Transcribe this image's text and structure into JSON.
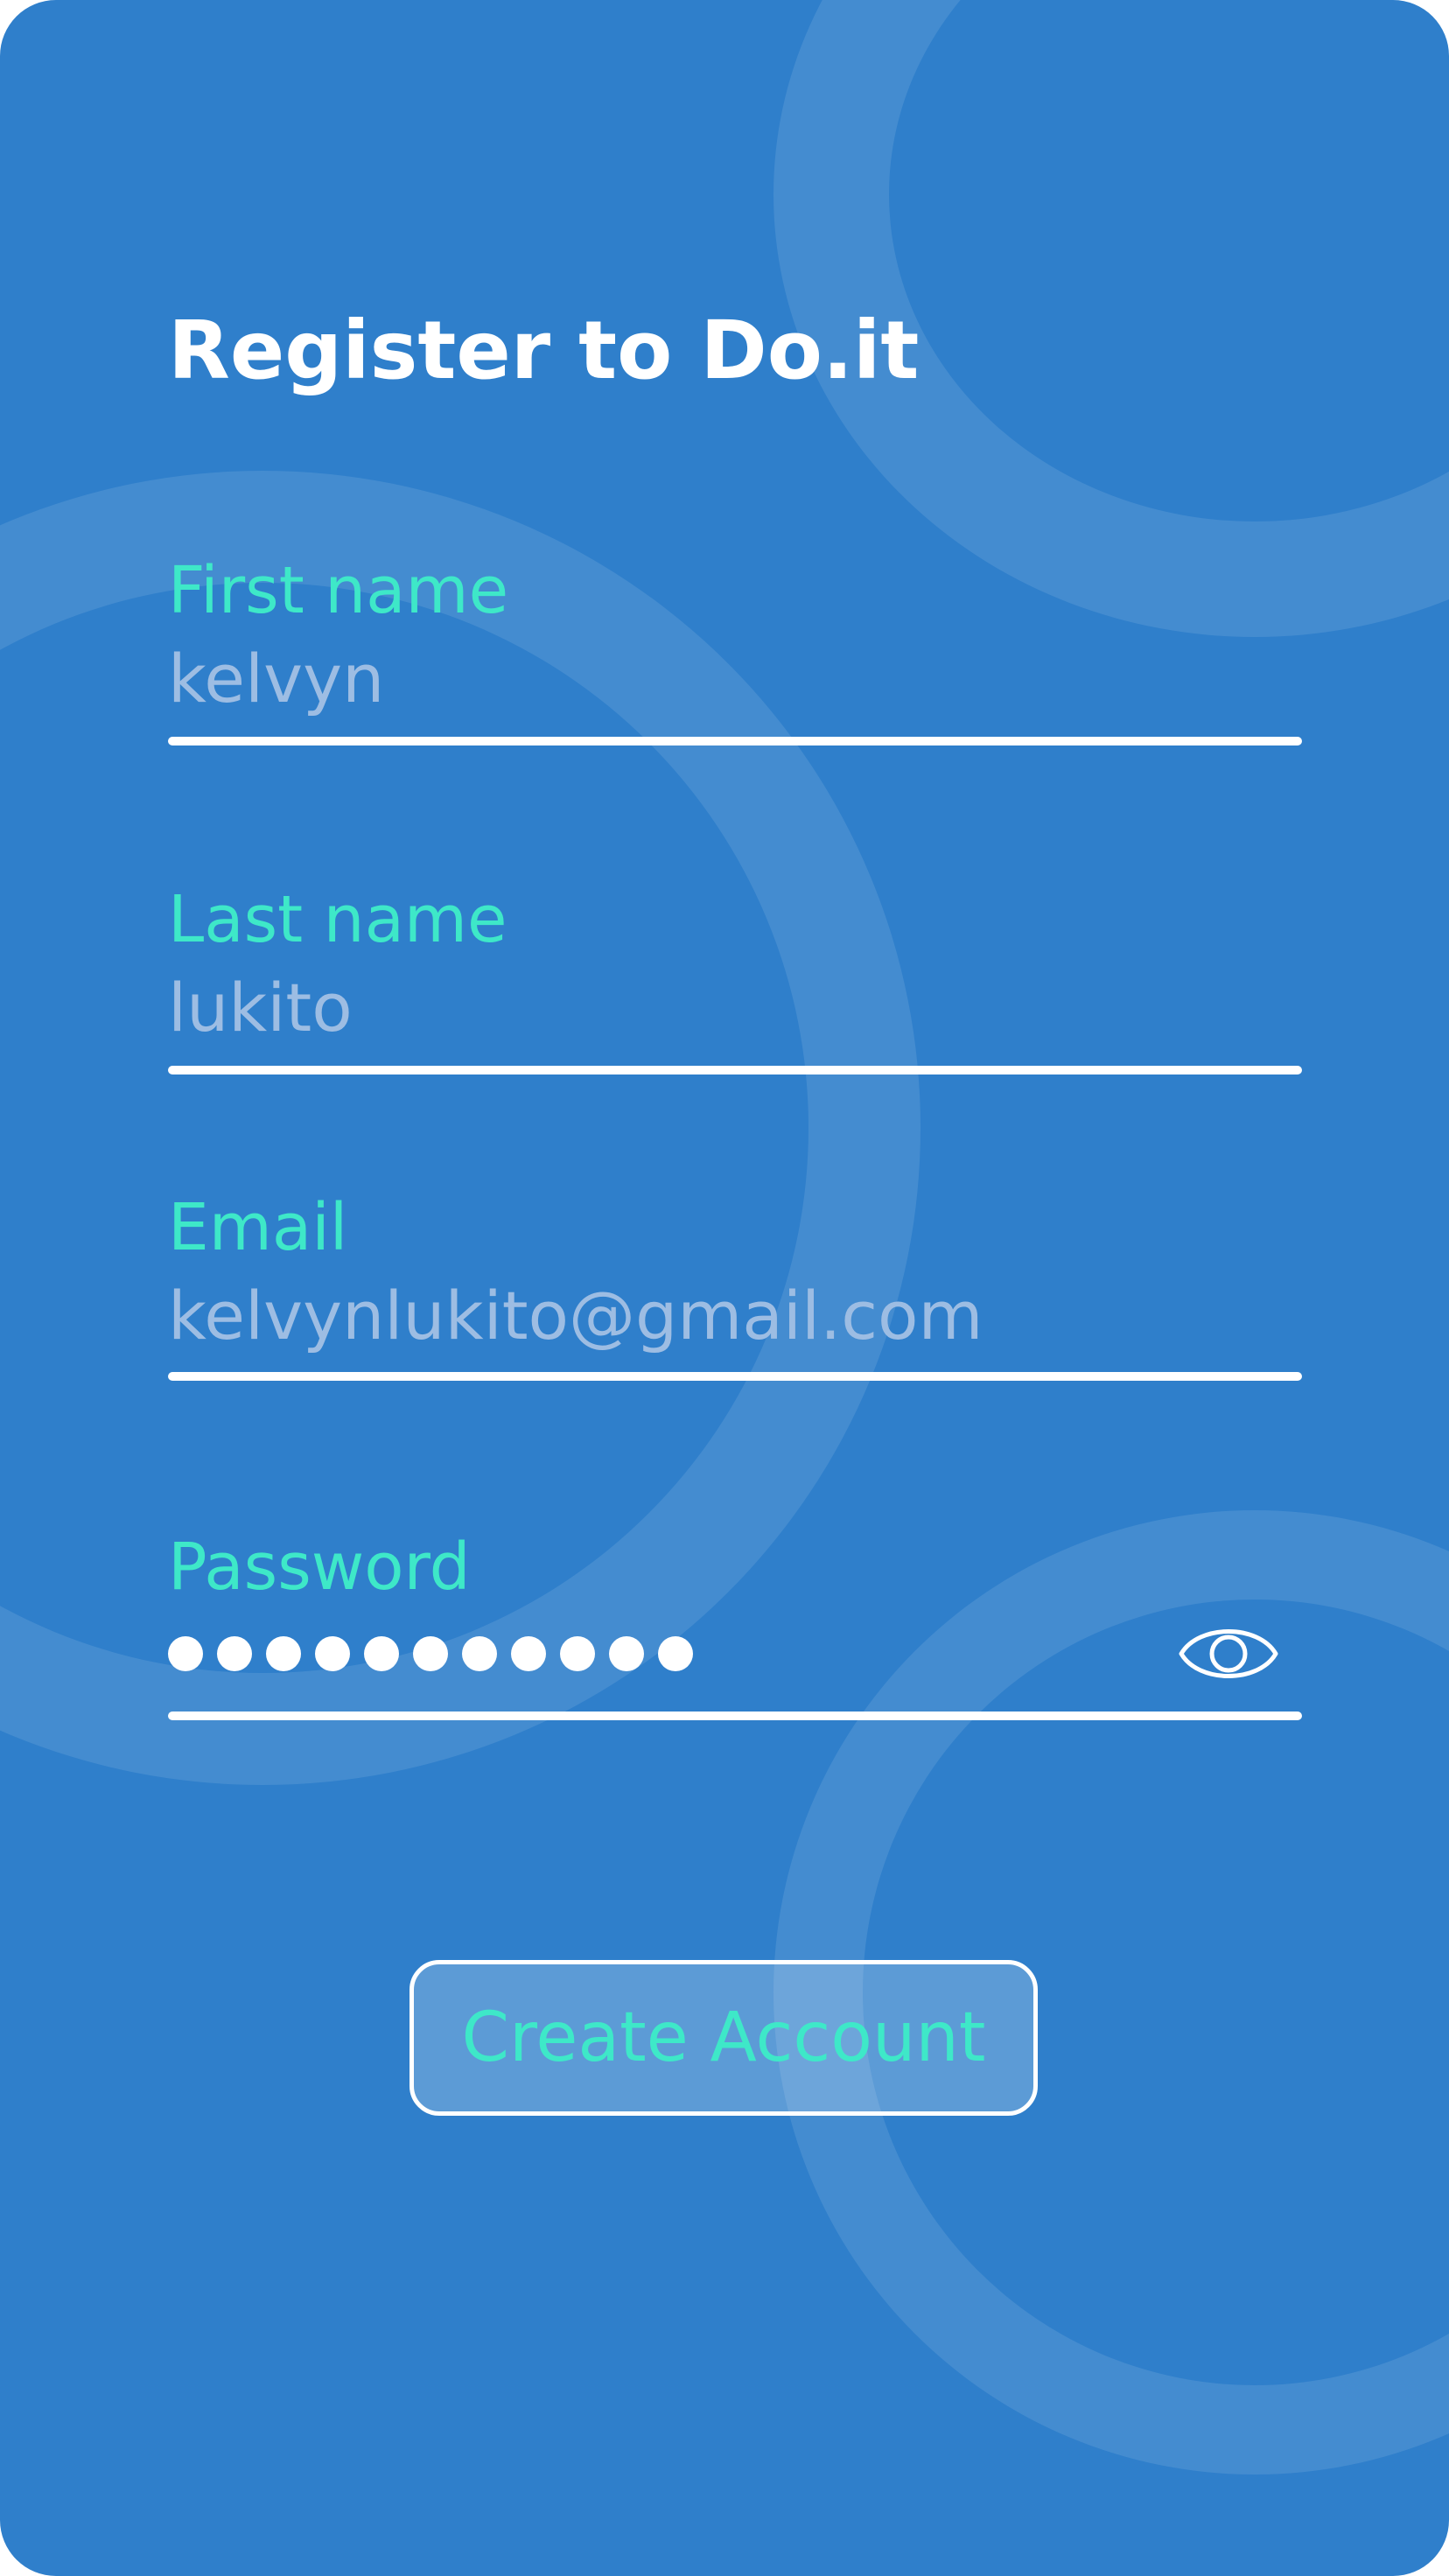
{
  "form": {
    "title": "Register to Do.it",
    "fields": [
      {
        "label": "First name",
        "value": "kelvyn"
      },
      {
        "label": "Last name",
        "value": "lukito"
      },
      {
        "label": "Email",
        "value": "kelvynlukito@gmail.com"
      },
      {
        "label": "Password",
        "masked_char_count": 11,
        "visibility_icon": "eye-icon"
      }
    ],
    "submit_label": "Create Account"
  },
  "colors": {
    "background": "#2f7fcb",
    "label_accent": "#3ee8c8",
    "input_text": "#9dbde3",
    "underline": "#ffffff"
  }
}
